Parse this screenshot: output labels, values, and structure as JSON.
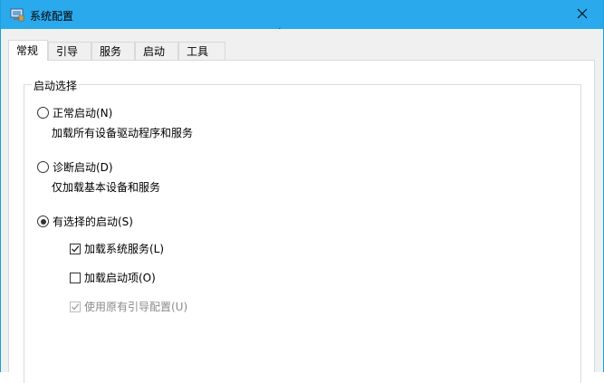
{
  "window": {
    "title": "系统配置",
    "close_glyph": "✕"
  },
  "tabs": [
    {
      "label": "常规"
    },
    {
      "label": "引导"
    },
    {
      "label": "服务"
    },
    {
      "label": "启动"
    },
    {
      "label": "工具"
    }
  ],
  "startup_group": {
    "legend": "启动选择",
    "options": [
      {
        "label": "正常启动(N)",
        "description": "加载所有设备驱动程序和服务",
        "selected": false
      },
      {
        "label": "诊断启动(D)",
        "description": "仅加载基本设备和服务",
        "selected": false
      },
      {
        "label": "有选择的启动(S)",
        "selected": true
      }
    ],
    "selective_checks": [
      {
        "label": "加载系统服务(L)",
        "checked": true,
        "enabled": true
      },
      {
        "label": "加载启动项(O)",
        "checked": false,
        "enabled": true
      },
      {
        "label": "使用原有引导配置(U)",
        "checked": true,
        "enabled": false
      }
    ]
  },
  "colors": {
    "titlebar": "#2aa9ec",
    "window_border": "#1a9fe0",
    "disabled_text": "#8a8a8a"
  },
  "icons": {
    "title": "system-config-icon",
    "close": "close-icon",
    "cursor": "mouse-cursor-icon"
  }
}
